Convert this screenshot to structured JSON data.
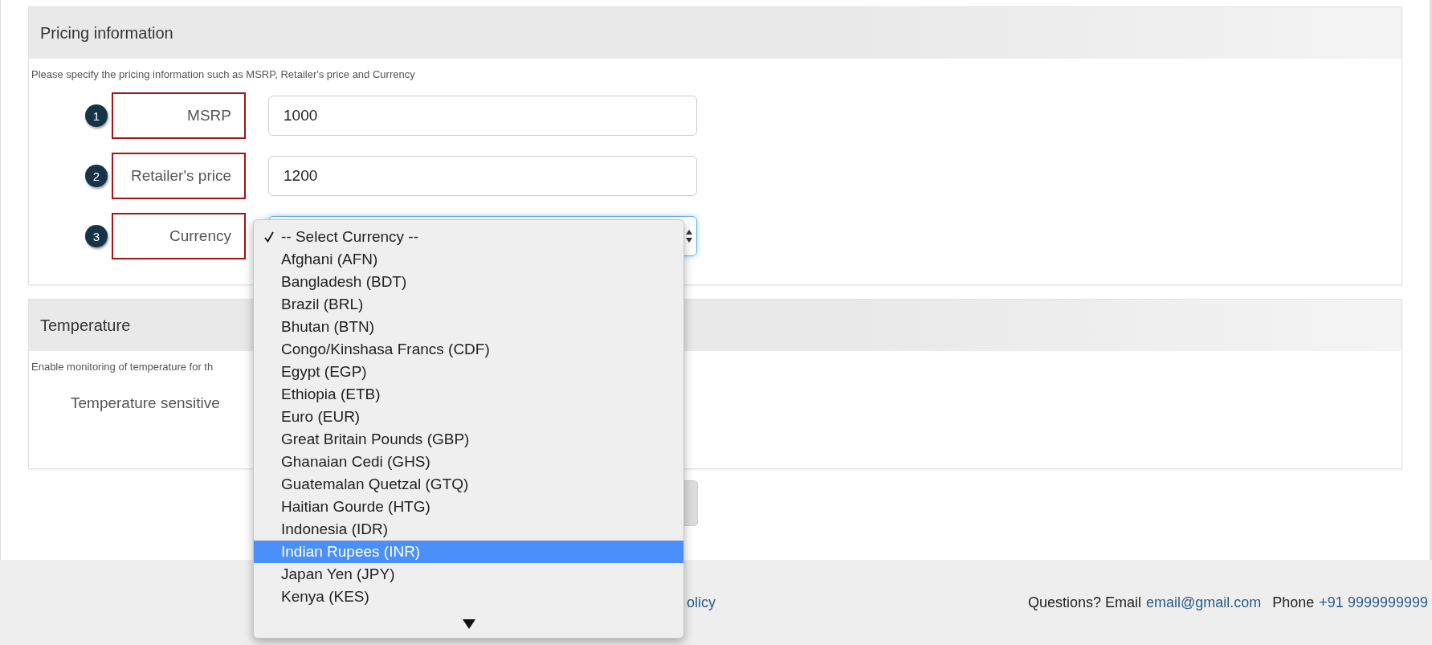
{
  "pricing": {
    "title": "Pricing information",
    "description": "Please specify the pricing information such as MSRP, Retailer's price and Currency",
    "fields": [
      {
        "badge": "1",
        "label": "MSRP",
        "kind": "text",
        "value": "1000"
      },
      {
        "badge": "2",
        "label": "Retailer's price",
        "kind": "text",
        "value": "1200"
      },
      {
        "badge": "3",
        "label": "Currency",
        "kind": "select"
      }
    ]
  },
  "currency_menu": {
    "more_below": true,
    "options": [
      {
        "label": "-- Select Currency --",
        "checked": true,
        "selected": false
      },
      {
        "label": "Afghani (AFN)",
        "checked": false,
        "selected": false
      },
      {
        "label": "Bangladesh (BDT)",
        "checked": false,
        "selected": false
      },
      {
        "label": "Brazil (BRL)",
        "checked": false,
        "selected": false
      },
      {
        "label": "Bhutan (BTN)",
        "checked": false,
        "selected": false
      },
      {
        "label": "Congo/Kinshasa Francs (CDF)",
        "checked": false,
        "selected": false
      },
      {
        "label": "Egypt (EGP)",
        "checked": false,
        "selected": false
      },
      {
        "label": "Ethiopia (ETB)",
        "checked": false,
        "selected": false
      },
      {
        "label": "Euro (EUR)",
        "checked": false,
        "selected": false
      },
      {
        "label": "Great Britain Pounds (GBP)",
        "checked": false,
        "selected": false
      },
      {
        "label": "Ghanaian Cedi (GHS)",
        "checked": false,
        "selected": false
      },
      {
        "label": "Guatemalan Quetzal (GTQ)",
        "checked": false,
        "selected": false
      },
      {
        "label": "Haitian Gourde (HTG)",
        "checked": false,
        "selected": false
      },
      {
        "label": "Indonesia (IDR)",
        "checked": false,
        "selected": false
      },
      {
        "label": "Indian Rupees (INR)",
        "checked": false,
        "selected": true
      },
      {
        "label": "Japan Yen (JPY)",
        "checked": false,
        "selected": false
      },
      {
        "label": "Kenya (KES)",
        "checked": false,
        "selected": false
      }
    ]
  },
  "temperature": {
    "title": "Temperature",
    "description": "Enable monitoring of temperature for th",
    "fields": [
      {
        "label": "Temperature sensitive"
      }
    ]
  },
  "footer": {
    "link_fragment": "olicy",
    "questions": "Questions? Email",
    "email": "email@gmail.com",
    "phone_label": "Phone",
    "phone": "+91 9999999999"
  }
}
